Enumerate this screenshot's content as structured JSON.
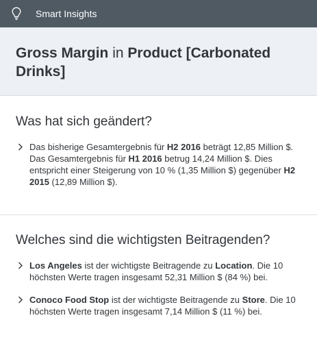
{
  "app": {
    "title": "Smart Insights",
    "icon": "lightbulb-icon"
  },
  "header": {
    "measure": "Gross Margin",
    "connector": "in",
    "dimension": "Product [Carbonated Drinks]"
  },
  "changes": {
    "title": "Was hat sich geändert?",
    "item": {
      "t1": "Das bisherige Gesamtergebnis für ",
      "p1": "H2 2016",
      "t2": " beträgt 12,85 Million $. Das Gesamtergebnis für ",
      "p2": "H1 2016",
      "t3": " betrug 14,24 Million $. Dies entspricht einer Steigerung von 10 % (1,35 Million $) gegenüber ",
      "p3": "H2 2015",
      "t4": " (12,89 Million $)."
    }
  },
  "contributors": {
    "title": "Welches sind die wichtigsten Beitragenden?",
    "items": [
      {
        "member": "Los Angeles",
        "t1": " ist der wichtigste Beitragende zu ",
        "dimension": "Location",
        "t2": ". Die 10 höchsten Werte tragen insgesamt 52,31 Million $ (84 %) bei."
      },
      {
        "member": "Conoco Food Stop",
        "t1": " ist der wichtigste Beitragende zu ",
        "dimension": "Store",
        "t2": ". Die 10 höchsten Werte tragen insgesamt 7,14 Million $ (11 %) bei."
      }
    ]
  },
  "colors": {
    "titlebar": "#4f5a63",
    "header_bg": "#edf1f5",
    "text": "#32363a"
  }
}
